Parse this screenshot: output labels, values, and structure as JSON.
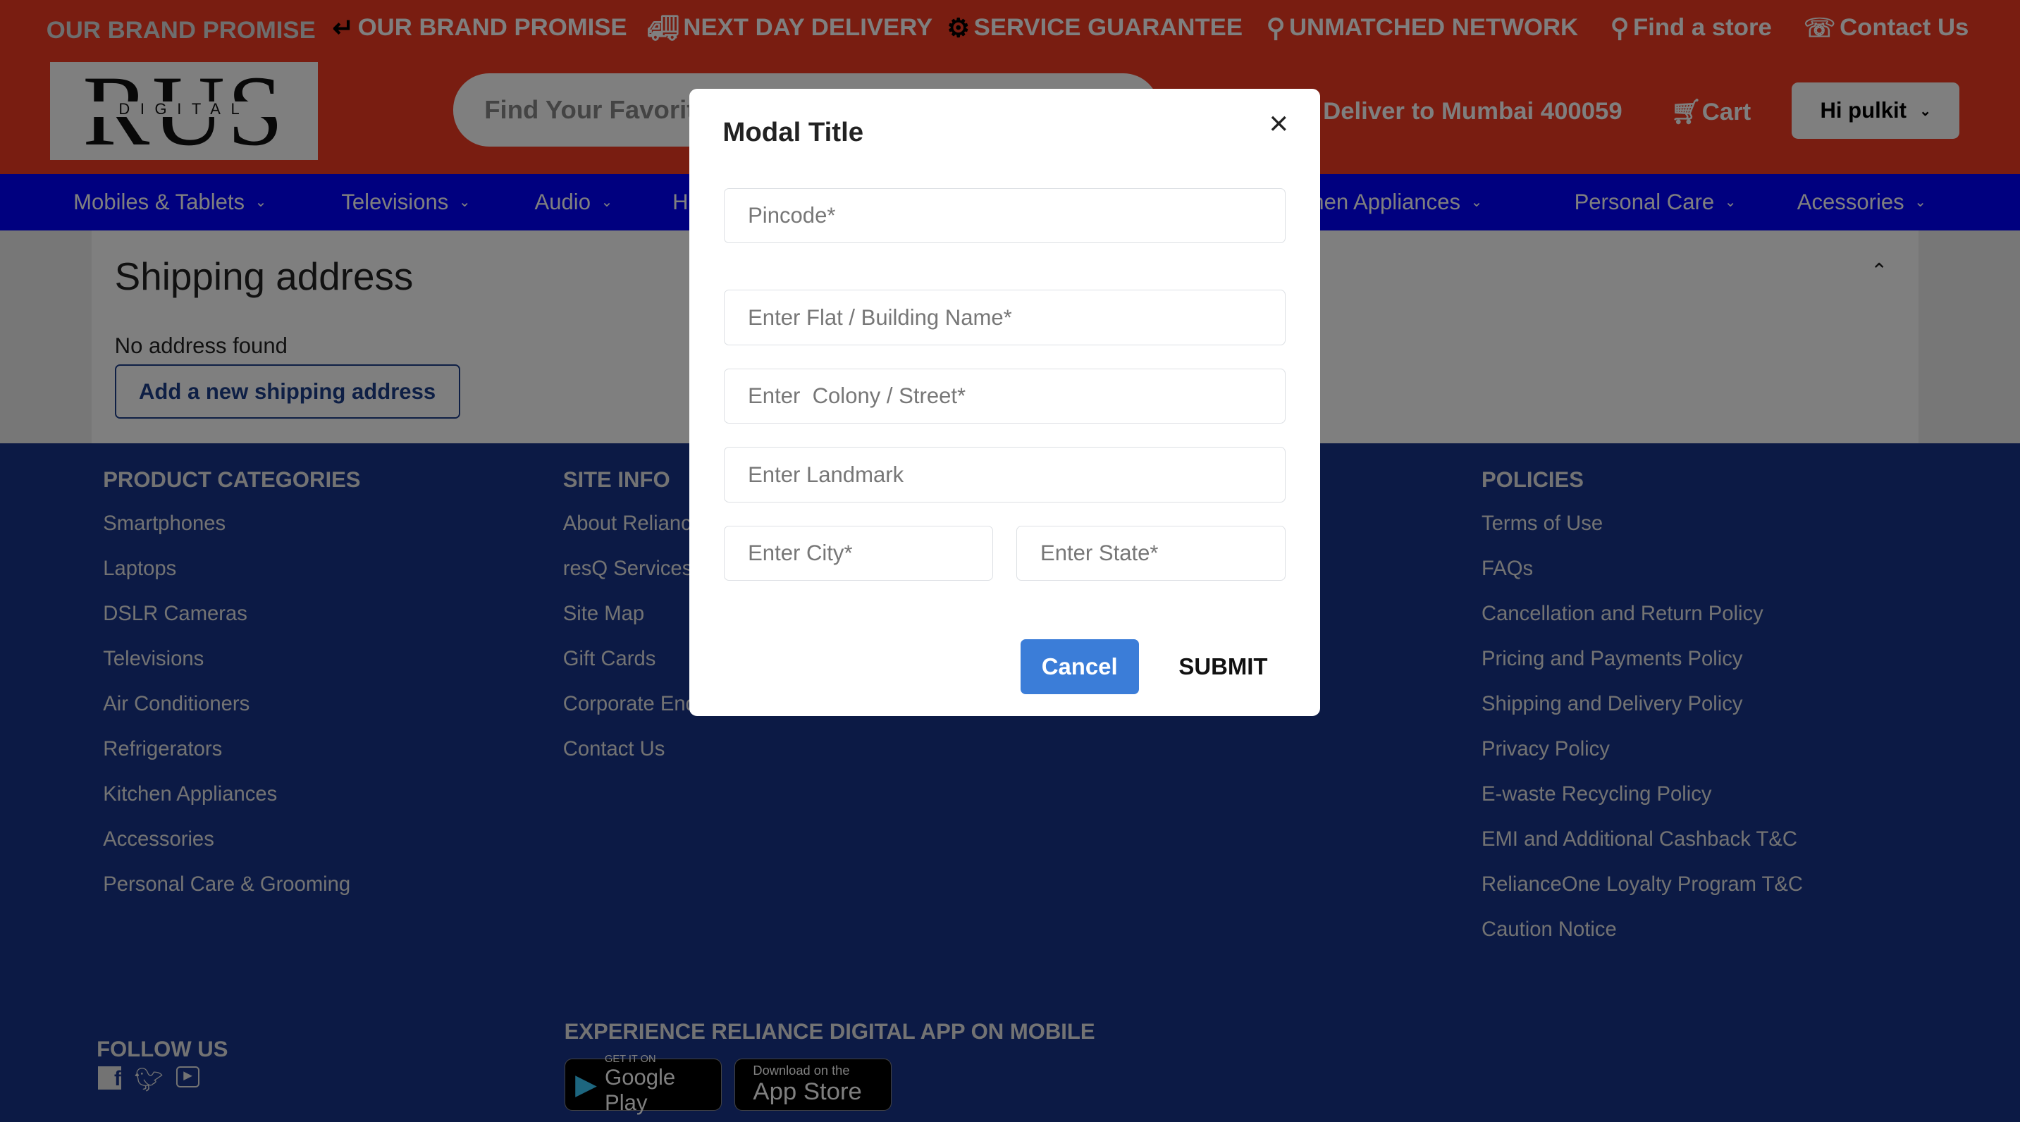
{
  "topbar": {
    "items": [
      {
        "label": "OUR BRAND PROMISE",
        "icon": ""
      },
      {
        "label": "OUR BRAND PROMISE",
        "icon": "return-arrow-icon"
      },
      {
        "label": "NEXT DAY DELIVERY",
        "icon": "truck-icon"
      },
      {
        "label": "SERVICE GUARANTEE",
        "icon": "gears-icon"
      },
      {
        "label": "UNMATCHED NETWORK",
        "icon": "network-icon"
      },
      {
        "label": "Find a store",
        "icon": "location-pin-icon"
      },
      {
        "label": "Contact Us",
        "icon": "phone-icon"
      }
    ]
  },
  "header": {
    "logo_text": "RUS",
    "logo_sub": "DIGITAL",
    "search_placeholder": "Find Your Favorite",
    "deliver": "Deliver to Mumbai 400059",
    "cart": "Cart",
    "user": "Hi pulkit"
  },
  "nav": {
    "items": [
      "Mobiles & Tablets",
      "Televisions",
      "Audio",
      "H",
      "Kitchen Appliances",
      "Personal Care",
      "Acessories"
    ]
  },
  "shipping": {
    "title": "Shipping address",
    "empty": "No address found",
    "add_button": "Add a new shipping address"
  },
  "footer": {
    "categories": {
      "heading": "PRODUCT CATEGORIES",
      "items": [
        "Smartphones",
        "Laptops",
        "DSLR Cameras",
        "Televisions",
        "Air Conditioners",
        "Refrigerators",
        "Kitchen Appliances",
        "Accessories",
        "Personal Care & Grooming"
      ]
    },
    "site_info": {
      "heading": "SITE INFO",
      "items": [
        "About Reliance Digital",
        "resQ Services",
        "Site Map",
        "Gift Cards",
        "Corporate Enquiries",
        "Contact Us"
      ]
    },
    "policies": {
      "heading": "POLICIES",
      "items": [
        "Terms of Use",
        "FAQs",
        "Cancellation and Return Policy",
        "Pricing and Payments Policy",
        "Shipping and Delivery Policy",
        "Privacy Policy",
        "E-waste Recycling Policy",
        "EMI and Additional Cashback T&C",
        "RelianceOne Loyalty Program T&C",
        "Caution Notice"
      ]
    },
    "follow": "FOLLOW US",
    "app_heading": "EXPERIENCE RELIANCE DIGITAL APP ON MOBILE",
    "google_small": "GET IT ON",
    "google_big": "Google Play",
    "apple_small": "Download on the",
    "apple_big": "App Store"
  },
  "modal": {
    "title": "Modal Title",
    "pincode": "Pincode*",
    "flat": "Enter Flat / Building Name*",
    "street": "Enter  Colony / Street*",
    "landmark": "Enter Landmark",
    "city": "Enter City*",
    "state": "Enter State*",
    "cancel": "Cancel",
    "submit": "SUBMIT",
    "cancel_color": "#3b7dd8"
  }
}
